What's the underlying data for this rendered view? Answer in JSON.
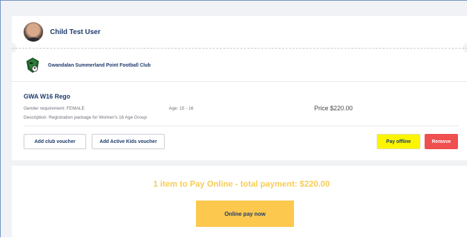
{
  "user": {
    "name": "Child Test User"
  },
  "club": {
    "name": "Gwandalan Summerland Point Football Club"
  },
  "item": {
    "title": "GWA W16 Rego",
    "gender": "Gender requirement: FEMALE",
    "age": "Age: 15 - 16",
    "price": "Price $220.00",
    "description": "Description: Registration package for Women's 16 Age Group"
  },
  "actions": {
    "club_voucher": "Add club voucher",
    "active_kids_voucher": "Add Active Kids voucher",
    "pay_offline": "Pay offline",
    "remove": "Remove"
  },
  "summary": {
    "total_text": "1 item to Pay Online - total payment: $220.00",
    "pay_button": "Online pay now"
  },
  "colors": {
    "navy": "#1d3a6b",
    "highlight": "#fbf500",
    "danger": "#ef4f4f",
    "pay_accent": "#fcc84e"
  }
}
